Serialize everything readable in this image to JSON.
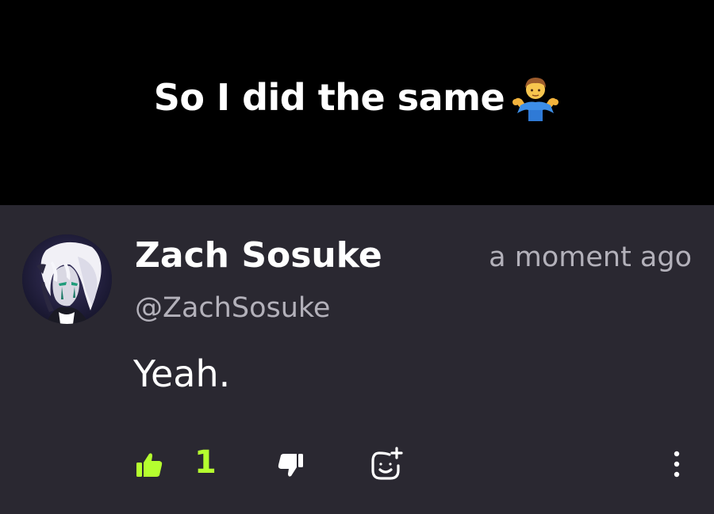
{
  "caption": {
    "text": "So I did the same",
    "emoji_icon": "person-shrugging-emoji"
  },
  "comment": {
    "author_name": "Zach Sosuke",
    "author_handle": "@ZachSosuke",
    "timestamp": "a moment ago",
    "body": "Yeah.",
    "like_count": "1",
    "avatar_icon": "anime-character-avatar"
  },
  "actions": {
    "like_icon": "thumbs-up-icon",
    "dislike_icon": "thumbs-down-icon",
    "emoji_react_icon": "add-emoji-reaction-icon",
    "more_icon": "more-vertical-icon"
  },
  "colors": {
    "card_background": "#2a2831",
    "caption_background": "#000000",
    "accent": "#b5ff2f",
    "secondary_text": "#b3b1ba"
  }
}
